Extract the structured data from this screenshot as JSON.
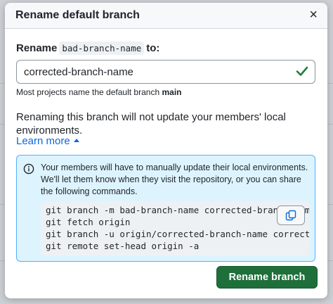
{
  "dialog": {
    "title": "Rename default branch",
    "close_glyph": "×"
  },
  "form": {
    "label_prefix": "Rename",
    "current_branch": "bad-branch-name",
    "label_suffix": "to:",
    "new_name_value": "corrected-branch-name",
    "valid_icon": "check-icon",
    "help_text": "Most projects name the default branch",
    "help_default": "main"
  },
  "warning": {
    "text": "Renaming this branch will not update your members' local environments.",
    "learn_more": "Learn more"
  },
  "alert": {
    "icon": "info-icon",
    "message": "Your members will have to manually update their local environments. We'll let them know when they visit the repository, or you can share the following commands.",
    "commands": [
      "git branch -m bad-branch-name corrected-branch-name",
      "git fetch origin",
      "git branch -u origin/corrected-branch-name corrected-branch-name",
      "git remote set-head origin -a"
    ],
    "copy_icon": "copy-icon"
  },
  "footer": {
    "submit_label": "Rename branch"
  },
  "colors": {
    "accent_blue": "#0969da",
    "success_green": "#1a7f37",
    "button_green": "#1f6f3a",
    "alert_bg": "#ddf4ff",
    "alert_border": "#54aeff"
  }
}
